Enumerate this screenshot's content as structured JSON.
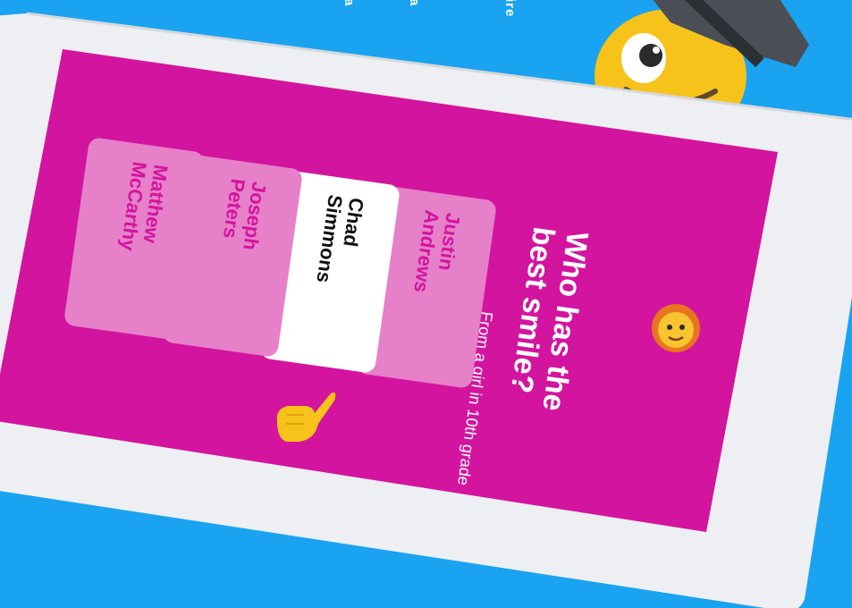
{
  "prompt": {
    "from_text": "From a girl in 10th grade",
    "question_line1": "Who has the",
    "question_line2": "best smile?"
  },
  "choices": [
    {
      "line1": "Justin",
      "line2": "Andrews",
      "selected": false
    },
    {
      "line1": "Chad",
      "line2": "Simmons",
      "selected": true
    },
    {
      "line1": "Joseph",
      "line2": "Peters",
      "selected": false
    },
    {
      "line1": "Matthew",
      "line2": "McCarthy",
      "selected": false
    }
  ],
  "background_text": {
    "fragment1": "a",
    "fragment2": "a",
    "fragment3": "ire"
  },
  "icons": {
    "avatar": "girl-emoji-icon",
    "pointer": "pointing-hand-icon",
    "mascot": "mascot-character-with-hat"
  },
  "colors": {
    "background": "#1aa3f0",
    "card": "#d3149f",
    "choice_unselected": "#e680c9",
    "choice_selected": "#ffffff",
    "phone_frame": "#f2f3f5"
  }
}
